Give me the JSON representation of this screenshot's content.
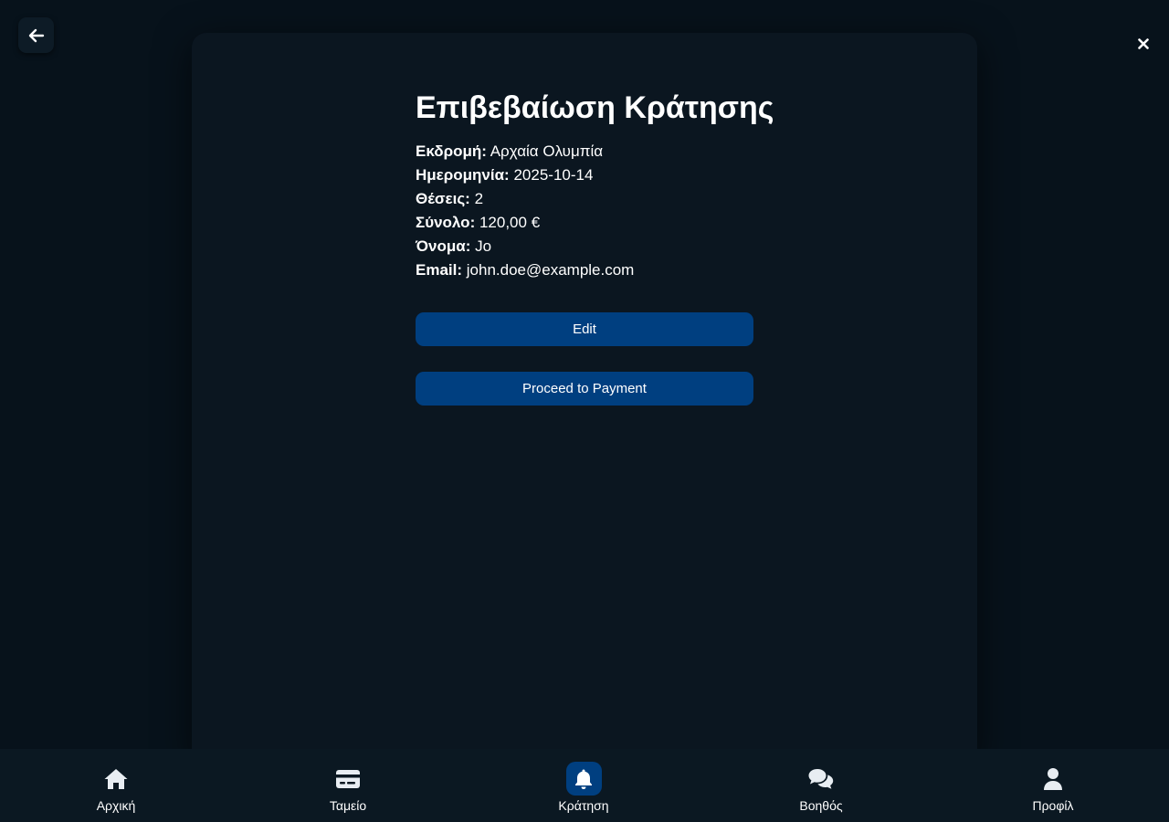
{
  "confirmation": {
    "title": "Επιβεβαίωση Κράτησης",
    "rows": [
      {
        "label": "Εκδρομή:",
        "value": "Αρχαία Ολυμπία"
      },
      {
        "label": "Ημερομηνία:",
        "value": "2025-10-14"
      },
      {
        "label": "Θέσεις:",
        "value": "2"
      },
      {
        "label": "Σύνολο:",
        "value": "120,00 €"
      },
      {
        "label": "Όνομα:",
        "value": "Jo"
      },
      {
        "label": "Email:",
        "value": "john.doe@example.com"
      }
    ],
    "edit_label": "Edit",
    "payment_label": "Proceed to Payment"
  },
  "nav": {
    "items": [
      {
        "label": "Αρχική",
        "icon": "home-icon",
        "active": false
      },
      {
        "label": "Ταμείο",
        "icon": "credit-card-icon",
        "active": false
      },
      {
        "label": "Κράτηση",
        "icon": "bell-icon",
        "active": true
      },
      {
        "label": "Βοηθός",
        "icon": "chat-icon",
        "active": false
      },
      {
        "label": "Προφίλ",
        "icon": "user-icon",
        "active": false
      }
    ]
  },
  "colors": {
    "background": "#07121b",
    "modal": "#0b1620",
    "primary_button": "#003f80",
    "nav_bar": "#0b1822"
  }
}
